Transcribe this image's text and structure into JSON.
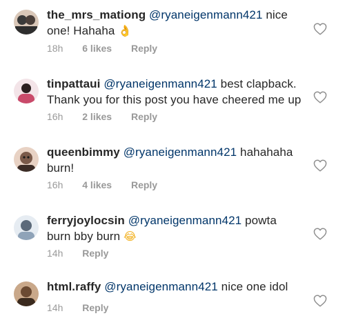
{
  "comments": [
    {
      "username": "the_mrs_mationg",
      "mention": "@ryaneigenmann421",
      "text": " nice one! Hahaha ",
      "emoji_icon": "ok-hand-icon",
      "emoji_glyph": "👌",
      "time": "18h",
      "likes": "6 likes",
      "reply": "Reply",
      "avatar_colors": [
        "#3a3a3a",
        "#d9c7b8"
      ]
    },
    {
      "username": "tinpattaui",
      "mention": "@ryaneigenmann421",
      "text": " best clapback. Thank you for this post you have cheered me up",
      "time": "16h",
      "likes": "2 likes",
      "reply": "Reply",
      "avatar_colors": [
        "#c94a6a",
        "#f3e4e8"
      ]
    },
    {
      "username": "queenbimmy",
      "mention": "@ryaneigenmann421",
      "text": " hahahaha burn!",
      "time": "16h",
      "likes": "4 likes",
      "reply": "Reply",
      "avatar_colors": [
        "#7a5a4a",
        "#e8d2c4"
      ]
    },
    {
      "username": "ferryjoylocsin",
      "mention": "@ryaneigenmann421",
      "text": " powta burn bby burn ",
      "emoji_icon": "tears-of-joy-icon",
      "emoji_glyph": "😂",
      "time": "14h",
      "reply": "Reply",
      "avatar_colors": [
        "#5c6a7a",
        "#e6ecf2"
      ]
    },
    {
      "username": "html.raffy",
      "mention": "@ryaneigenmann421",
      "text": " nice one idol",
      "time": "14h",
      "reply": "Reply",
      "avatar_colors": [
        "#6b4a32",
        "#c9a88a"
      ]
    }
  ]
}
